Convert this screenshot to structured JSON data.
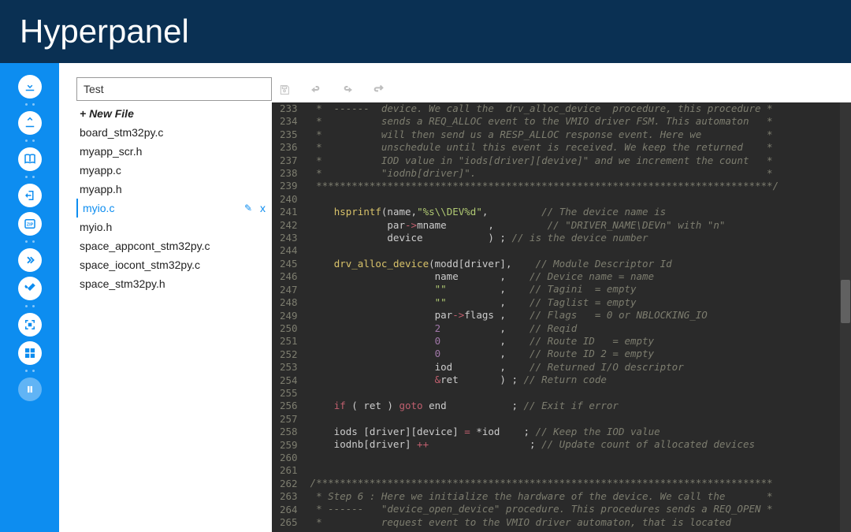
{
  "brand": "Hyperpanel",
  "filePanel": {
    "inputValue": "Test",
    "newFileLabel": "+ New File",
    "files": [
      {
        "name": "board_stm32py.c",
        "active": false
      },
      {
        "name": "myapp_scr.h",
        "active": false
      },
      {
        "name": "myapp.c",
        "active": false
      },
      {
        "name": "myapp.h",
        "active": false
      },
      {
        "name": "myio.c",
        "active": true
      },
      {
        "name": "myio.h",
        "active": false
      },
      {
        "name": "space_appcont_stm32py.c",
        "active": false
      },
      {
        "name": "space_iocont_stm32py.c",
        "active": false
      },
      {
        "name": "space_stm32py.h",
        "active": false
      }
    ],
    "editIcon": "✎",
    "closeIcon": "x"
  },
  "editor": {
    "firstLine": 233,
    "lines": [
      {
        "n": 233,
        "t": "comment",
        "s": " *  ------  device. We call the  drv_alloc_device  procedure, this procedure *"
      },
      {
        "n": 234,
        "t": "comment",
        "s": " *          sends a REQ_ALLOC event to the VMIO driver FSM. This automaton   *"
      },
      {
        "n": 235,
        "t": "comment",
        "s": " *          will then send us a RESP_ALLOC response event. Here we           *"
      },
      {
        "n": 236,
        "t": "comment",
        "s": " *          unschedule until this event is received. We keep the returned    *"
      },
      {
        "n": 237,
        "t": "comment",
        "s": " *          IOD value in \"iods[driver][devive]\" and we increment the count   *"
      },
      {
        "n": 238,
        "t": "comment",
        "s": " *          \"iodnb[driver]\".                                                 *"
      },
      {
        "n": 239,
        "t": "comment",
        "s": " *****************************************************************************/"
      },
      {
        "n": 240,
        "t": "blank",
        "s": ""
      },
      {
        "n": 241,
        "t": "code",
        "tokens": [
          [
            "    ",
            ""
          ],
          [
            "hsprintf",
            "func"
          ],
          [
            "(name,",
            "punct"
          ],
          [
            "\"%s\\\\DEV%d\"",
            "str"
          ],
          [
            ",         ",
            "punct"
          ],
          [
            "// The device name is",
            "comment"
          ]
        ]
      },
      {
        "n": 242,
        "t": "code",
        "tokens": [
          [
            "             par",
            "ident"
          ],
          [
            "->",
            "op"
          ],
          [
            "mname       ",
            "ident"
          ],
          [
            ",         ",
            "punct"
          ],
          [
            "// \"DRIVER_NAME\\DEVn\" with \"n\"",
            "comment"
          ]
        ]
      },
      {
        "n": 243,
        "t": "code",
        "tokens": [
          [
            "             device           ",
            "ident"
          ],
          [
            ") ",
            "punct"
          ],
          [
            "; ",
            "punct"
          ],
          [
            "// is the device number",
            "comment"
          ]
        ]
      },
      {
        "n": 244,
        "t": "blank",
        "s": ""
      },
      {
        "n": 245,
        "t": "code",
        "tokens": [
          [
            "    ",
            ""
          ],
          [
            "drv_alloc_device",
            "func"
          ],
          [
            "(modd[driver],    ",
            "punct"
          ],
          [
            "// Module Descriptor Id",
            "comment"
          ]
        ]
      },
      {
        "n": 246,
        "t": "code",
        "tokens": [
          [
            "                     name       ",
            "ident"
          ],
          [
            ",    ",
            "punct"
          ],
          [
            "// Device name = name",
            "comment"
          ]
        ]
      },
      {
        "n": 247,
        "t": "code",
        "tokens": [
          [
            "                     ",
            ""
          ],
          [
            "\"\"",
            "str"
          ],
          [
            "         ,    ",
            "punct"
          ],
          [
            "// Tagini  = empty",
            "comment"
          ]
        ]
      },
      {
        "n": 248,
        "t": "code",
        "tokens": [
          [
            "                     ",
            ""
          ],
          [
            "\"\"",
            "str"
          ],
          [
            "         ,    ",
            "punct"
          ],
          [
            "// Taglist = empty",
            "comment"
          ]
        ]
      },
      {
        "n": 249,
        "t": "code",
        "tokens": [
          [
            "                     par",
            "ident"
          ],
          [
            "->",
            "op"
          ],
          [
            "flags ",
            "ident"
          ],
          [
            ",    ",
            "punct"
          ],
          [
            "// Flags   = 0 or NBLOCKING_IO",
            "comment"
          ]
        ]
      },
      {
        "n": 250,
        "t": "code",
        "tokens": [
          [
            "                     ",
            ""
          ],
          [
            "2",
            "num"
          ],
          [
            "          ,    ",
            "punct"
          ],
          [
            "// Reqid",
            "comment"
          ]
        ]
      },
      {
        "n": 251,
        "t": "code",
        "tokens": [
          [
            "                     ",
            ""
          ],
          [
            "0",
            "num"
          ],
          [
            "          ,    ",
            "punct"
          ],
          [
            "// Route ID   = empty",
            "comment"
          ]
        ]
      },
      {
        "n": 252,
        "t": "code",
        "tokens": [
          [
            "                     ",
            ""
          ],
          [
            "0",
            "num"
          ],
          [
            "          ,    ",
            "punct"
          ],
          [
            "// Route ID 2 = empty",
            "comment"
          ]
        ]
      },
      {
        "n": 253,
        "t": "code",
        "tokens": [
          [
            "                     iod        ",
            "ident"
          ],
          [
            ",    ",
            "punct"
          ],
          [
            "// Returned I/O descriptor",
            "comment"
          ]
        ]
      },
      {
        "n": 254,
        "t": "code",
        "tokens": [
          [
            "                     ",
            "ident"
          ],
          [
            "&",
            "op"
          ],
          [
            "ret       ",
            "ident"
          ],
          [
            ") ; ",
            "punct"
          ],
          [
            "// Return code",
            "comment"
          ]
        ]
      },
      {
        "n": 255,
        "t": "blank",
        "s": ""
      },
      {
        "n": 256,
        "t": "code",
        "tokens": [
          [
            "    ",
            ""
          ],
          [
            "if",
            "kw"
          ],
          [
            " ( ret ) ",
            "punct"
          ],
          [
            "goto",
            "kw"
          ],
          [
            " end           ; ",
            "punct"
          ],
          [
            "// Exit if error",
            "comment"
          ]
        ]
      },
      {
        "n": 257,
        "t": "blank",
        "s": ""
      },
      {
        "n": 258,
        "t": "code",
        "tokens": [
          [
            "    iods [driver][device] ",
            "ident"
          ],
          [
            "=",
            "op"
          ],
          [
            " *iod    ; ",
            "punct"
          ],
          [
            "// Keep the IOD value",
            "comment"
          ]
        ]
      },
      {
        "n": 259,
        "t": "code",
        "tokens": [
          [
            "    iodnb[driver] ",
            "ident"
          ],
          [
            "++",
            "op"
          ],
          [
            "                 ; ",
            "punct"
          ],
          [
            "// Update count of allocated devices",
            "comment"
          ]
        ]
      },
      {
        "n": 260,
        "t": "blank",
        "s": ""
      },
      {
        "n": 261,
        "t": "blank",
        "s": ""
      },
      {
        "n": 262,
        "t": "comment",
        "s": "/*****************************************************************************"
      },
      {
        "n": 263,
        "t": "comment",
        "s": " * Step 6 : Here we initialize the hardware of the device. We call the       *"
      },
      {
        "n": 264,
        "t": "comment",
        "s": " * ------   \"device_open_device\" procedure. This procedures sends a REQ_OPEN *"
      },
      {
        "n": 265,
        "t": "comment",
        "s": " *          request event to the VMIO driver automaton, that is located       "
      }
    ]
  }
}
